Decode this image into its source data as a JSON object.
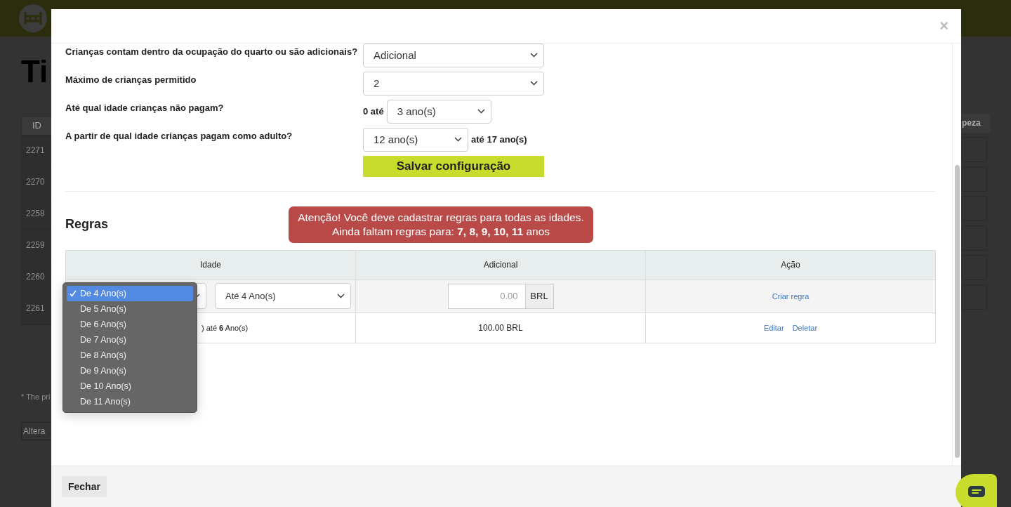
{
  "background": {
    "title": "Ti",
    "id_column": "ID",
    "ids": [
      "2271",
      "2270",
      "2258",
      "2259",
      "2260",
      "2261"
    ],
    "cut_column": "peza",
    "note": "* The pri",
    "button": "Altera"
  },
  "modal": {
    "close": "×",
    "settings": [
      {
        "kind": "select",
        "label": "Crianças contam dentro da ocupação do quarto ou são adicionais?",
        "value": "Adicional"
      },
      {
        "kind": "select",
        "label": "Máximo de crianças permitido",
        "value": "2"
      },
      {
        "kind": "prefix_select",
        "label": "Até qual idade crianças não pagam?",
        "prefix": "0 até",
        "value": "3 ano(s)"
      },
      {
        "kind": "suffix_select",
        "label": "A partir de qual idade crianças pagam como adulto?",
        "value": "12 ano(s)",
        "suffix": "até 17 ano(s)"
      }
    ],
    "save_button": "Salvar configuração",
    "rules": {
      "title": "Regras",
      "alert": [
        "Atenção! Você deve cadastrar regras para todas as idades.",
        "Ainda faltam regras para: **7, 8, 9, 10, 11** anos"
      ],
      "columns": [
        "Idade",
        "Adicional",
        "Ação"
      ],
      "new_rule": {
        "to_select": "Até 4 Ano(s)",
        "amount_placeholder": "0.00",
        "currency": "BRL",
        "action": "Criar regra"
      },
      "rows": [
        {
          "age": ") até **6** Ano(s)",
          "amount": "100.00 BRL",
          "actions": [
            "Editar",
            "Deletar"
          ]
        }
      ],
      "age_dropdown": [
        {
          "label": "De 4 Ano(s)",
          "selected": true
        },
        {
          "label": "De 5 Ano(s)",
          "selected": false
        },
        {
          "label": "De 6 Ano(s)",
          "selected": false
        },
        {
          "label": "De 7 Ano(s)",
          "selected": false
        },
        {
          "label": "De 8 Ano(s)",
          "selected": false
        },
        {
          "label": "De 9 Ano(s)",
          "selected": false
        },
        {
          "label": "De 10 Ano(s)",
          "selected": false
        },
        {
          "label": "De 11 Ano(s)",
          "selected": false
        }
      ]
    },
    "footer_button": "Fechar"
  }
}
